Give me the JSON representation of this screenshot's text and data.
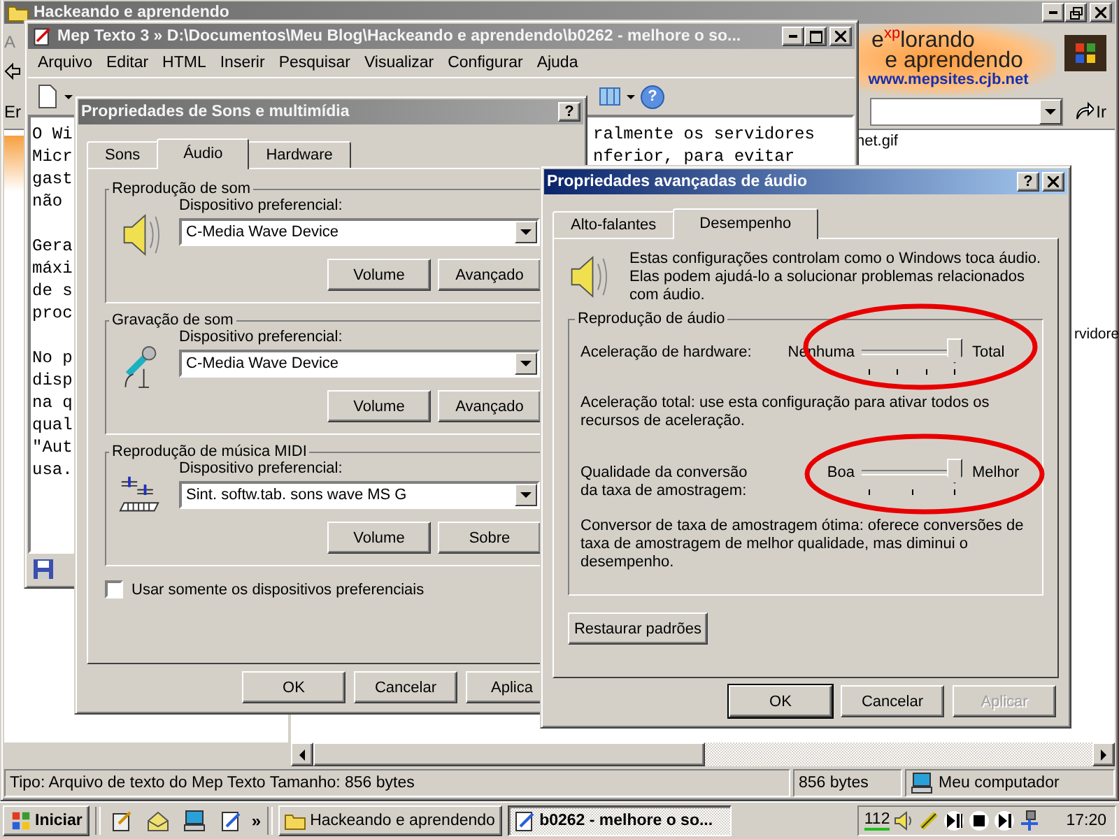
{
  "explorer": {
    "title": "Hackeando e aprendendo",
    "menu_fragment": "A",
    "address_fragment": "Er",
    "go_button": "Ir",
    "logo": {
      "line1": "e$^{xp}$lorando",
      "line2": "e aprendendo",
      "url": "www.mepsites.cjb.net"
    },
    "files": [
      "net.gif",
      "rvidore"
    ],
    "status_bar": [
      "Tipo: Arquivo de texto do Mep Texto Tamanho: 856 bytes",
      "856 bytes",
      "Meu computador"
    ]
  },
  "editor": {
    "title": "Mep Texto 3 » D:\\Documentos\\Meu Blog\\Hackeando e aprendendo\\b0262 - melhore o so...",
    "menu": [
      "Arquivo",
      "Editar",
      "HTML",
      "Inserir",
      "Pesquisar",
      "Visualizar",
      "Configurar",
      "Ajuda"
    ],
    "help_glyph": "?",
    "lines": [
      {
        "kind": "text",
        "text": "O Wi",
        "tail": "ralmente os servidores"
      },
      {
        "kind": "text",
        "text": "Micr",
        "tail": "nferior, para evitar"
      },
      {
        "kind": "text",
        "text": "gast"
      },
      {
        "kind": "text",
        "text": "não"
      },
      {
        "kind": "blank"
      },
      {
        "kind": "text",
        "text": "Gera"
      },
      {
        "kind": "text",
        "text": "máxi"
      },
      {
        "kind": "text",
        "text": "de s"
      },
      {
        "kind": "text",
        "text": "proc"
      },
      {
        "kind": "blank"
      },
      {
        "kind": "text",
        "text": "No p"
      },
      {
        "kind": "text",
        "text": "disp"
      },
      {
        "kind": "text",
        "text": "na q"
      },
      {
        "kind": "text",
        "text": "qual"
      },
      {
        "kind": "text",
        "text": "\"Aut"
      },
      {
        "kind": "text",
        "text": "usa."
      }
    ]
  },
  "sound_dialog": {
    "title": "Propriedades de Sons e multimídia",
    "help_button": "?",
    "tabs": [
      {
        "label": "Sons",
        "selected": false
      },
      {
        "label": "Áudio",
        "selected": true
      },
      {
        "label": "Hardware",
        "selected": false
      }
    ],
    "groups": [
      {
        "title": "Reprodução de som",
        "kind": "speaker",
        "device_label": "Dispositivo preferencial:",
        "device": "C-Media Wave Device",
        "buttons": [
          "Volume",
          "Avançado"
        ]
      },
      {
        "title": "Gravação de som",
        "kind": "microphone",
        "device_label": "Dispositivo preferencial:",
        "device": "C-Media Wave Device",
        "buttons": [
          "Volume",
          "Avançado"
        ]
      },
      {
        "title": "Reprodução de música MIDI",
        "kind": "midi",
        "device_label": "Dispositivo preferencial:",
        "device": "Sint. softw.tab. sons wave MS G",
        "buttons": [
          "Volume",
          "Sobre"
        ]
      }
    ],
    "checkbox": {
      "label": "Usar somente os dispositivos preferenciais",
      "checked": false
    },
    "buttons": [
      {
        "label": "OK",
        "disabled": false
      },
      {
        "label": "Cancelar",
        "disabled": false
      },
      {
        "label": "Aplica",
        "disabled": false
      }
    ]
  },
  "advanced_dialog": {
    "title": "Propriedades avançadas de áudio",
    "help_button": "?",
    "tabs": [
      {
        "label": "Alto-falantes",
        "selected": false
      },
      {
        "label": "Desempenho",
        "selected": true
      }
    ],
    "intro": "Estas configurações controlam como o Windows toca áudio. Elas podem ajudá-lo a solucionar problemas relacionados com áudio.",
    "group_title": "Reprodução de áudio",
    "settings": [
      {
        "label": "Aceleração de hardware:",
        "min_label": "Nenhuma",
        "max_label": "Total",
        "level": 1,
        "description": "Aceleração total: use esta configuração para ativar todos os recursos de aceleração."
      },
      {
        "label": "Qualidade da conversão da taxa de amostragem:",
        "min_label": "Boa",
        "max_label": "Melhor",
        "level": 1,
        "description": "Conversor de taxa de amostragem ótima: oferece conversões de taxa de amostragem de melhor qualidade, mas diminui o desempenho."
      }
    ],
    "restore_button": "Restaurar padrões",
    "buttons": [
      {
        "label": "OK",
        "disabled": false
      },
      {
        "label": "Cancelar",
        "disabled": false
      },
      {
        "label": "Aplicar",
        "disabled": true
      }
    ]
  },
  "taskbar": {
    "start": "Iniciar",
    "more": "»",
    "tasks": [
      {
        "label": "Hackeando e aprendendo",
        "selected": false
      },
      {
        "label": "b0262 - melhore o so...",
        "selected": true
      }
    ],
    "tray": {
      "meter": "112",
      "clock": "17:20"
    }
  }
}
